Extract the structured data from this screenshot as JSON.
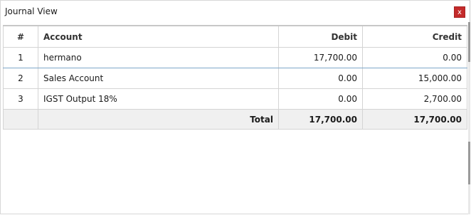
{
  "window": {
    "title": "Journal View",
    "close_label": "x"
  },
  "table": {
    "columns": [
      "#",
      "Account",
      "Debit",
      "Credit"
    ],
    "rows": [
      {
        "index": "1",
        "account": "hermano",
        "debit": "17,700.00",
        "credit": "0.00"
      },
      {
        "index": "2",
        "account": "Sales Account",
        "debit": "0.00",
        "credit": "15,000.00"
      },
      {
        "index": "3",
        "account": "IGST Output 18%",
        "debit": "0.00",
        "credit": "2,700.00"
      }
    ],
    "footer": {
      "label": "Total",
      "debit_total": "17,700.00",
      "credit_total": "17,700.00"
    }
  },
  "colors": {
    "close_button": "#c42b2b",
    "footer_bg": "#f0f0f0",
    "selected_row_border": "#7fa7c9"
  }
}
